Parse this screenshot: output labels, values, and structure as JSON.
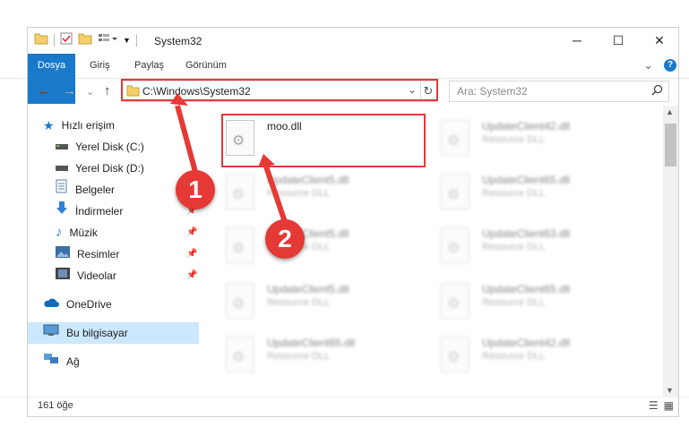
{
  "window": {
    "title": "System32",
    "minimize": "─",
    "maximize": "☐",
    "close": "✕"
  },
  "ribbon": {
    "tabs": [
      "Dosya",
      "Giriş",
      "Paylaş",
      "Görünüm"
    ],
    "expand": "⌄",
    "help": "?"
  },
  "address": {
    "path": "C:\\Windows\\System32",
    "dropdown": "⌄",
    "refresh": "↻"
  },
  "search": {
    "placeholder": "Ara: System32",
    "icon": "search-icon"
  },
  "navigation": {
    "back": "←",
    "forward": "→",
    "recent": "⌄",
    "up": "↑"
  },
  "sidebar": {
    "quick_access": "Hızlı erişim",
    "items": [
      {
        "label": "Yerel Disk (C:)",
        "icon": "drive-icon",
        "pinned": false
      },
      {
        "label": "Yerel Disk (D:)",
        "icon": "drive-icon",
        "pinned": false
      },
      {
        "label": "Belgeler",
        "icon": "documents-icon",
        "pinned": true
      },
      {
        "label": "İndirmeler",
        "icon": "downloads-icon",
        "pinned": true
      },
      {
        "label": "Müzik",
        "icon": "music-icon",
        "pinned": true
      },
      {
        "label": "Resimler",
        "icon": "pictures-icon",
        "pinned": true
      },
      {
        "label": "Videolar",
        "icon": "videos-icon",
        "pinned": true
      }
    ],
    "onedrive": "OneDrive",
    "this_pc": "Bu bilgisayar",
    "network": "Ağ"
  },
  "files": [
    {
      "name": "moo.dll",
      "type": "",
      "highlighted": true
    },
    {
      "name": "UpdateClient42.dll",
      "type": "Resource DLL"
    },
    {
      "name": "UpdateClient5.dll",
      "type": "Resource DLL"
    },
    {
      "name": "UpdateClient65.dll",
      "type": "Resource DLL"
    },
    {
      "name": "UpdateClient5.dll",
      "type": "Resource DLL"
    },
    {
      "name": "UpdateClient63.dll",
      "type": "Resource DLL"
    },
    {
      "name": "UpdateClient5.dll",
      "type": "Resource DLL"
    },
    {
      "name": "UpdateClient65.dll",
      "type": "Resource DLL"
    },
    {
      "name": "UpdateClient65.dll",
      "type": "Resource DLL"
    },
    {
      "name": "UpdateClient42.dll",
      "type": "Resource DLL"
    }
  ],
  "status": {
    "count": "161 öğe"
  },
  "annotations": {
    "step1": "1",
    "step2": "2"
  },
  "colors": {
    "accent": "#1979ca",
    "highlight": "#e03a3a",
    "badge": "#e53935",
    "selection": "#cce8ff"
  }
}
